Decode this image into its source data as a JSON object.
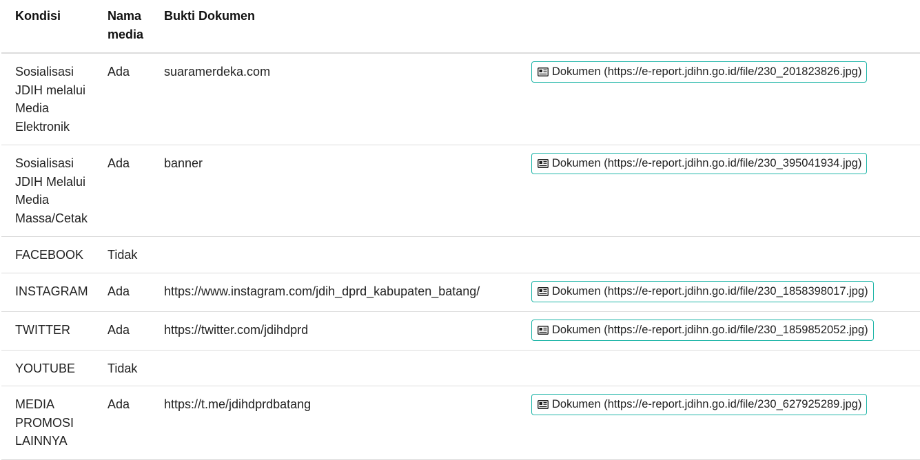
{
  "table": {
    "headers": {
      "kondisi": "Kondisi",
      "nama_media": "Nama media",
      "bukti_dokumen": "Bukti Dokumen"
    },
    "rows": [
      {
        "kondisi": "Sosialisasi JDIH melalui Media Elektronik",
        "status": "Ada",
        "nama_media": "suaramerdeka.com",
        "dokumen": "Dokumen (https://e-report.jdihn.go.id/file/230_201823826.jpg)"
      },
      {
        "kondisi": "Sosialisasi JDIH Melalui Media Massa/Cetak",
        "status": "Ada",
        "nama_media": "banner",
        "dokumen": "Dokumen (https://e-report.jdihn.go.id/file/230_395041934.jpg)"
      },
      {
        "kondisi": "FACEBOOK",
        "status": "Tidak",
        "nama_media": "",
        "dokumen": ""
      },
      {
        "kondisi": "INSTAGRAM",
        "status": "Ada",
        "nama_media": "https://www.instagram.com/jdih_dprd_kabupaten_batang/",
        "dokumen": "Dokumen (https://e-report.jdihn.go.id/file/230_1858398017.jpg)"
      },
      {
        "kondisi": "TWITTER",
        "status": "Ada",
        "nama_media": "https://twitter.com/jdihdprd",
        "dokumen": "Dokumen (https://e-report.jdihn.go.id/file/230_1859852052.jpg)"
      },
      {
        "kondisi": "YOUTUBE",
        "status": "Tidak",
        "nama_media": "",
        "dokumen": ""
      },
      {
        "kondisi": "MEDIA PROMOSI LAINNYA",
        "status": "Ada",
        "nama_media": "https://t.me/jdihdprdbatang",
        "dokumen": "Dokumen (https://e-report.jdihn.go.id/file/230_627925289.jpg)"
      }
    ]
  },
  "icons": {
    "document_button_icon": "newspaper-icon"
  },
  "colors": {
    "button_border": "#1fb5a8",
    "row_divider": "#dcdcdc"
  }
}
